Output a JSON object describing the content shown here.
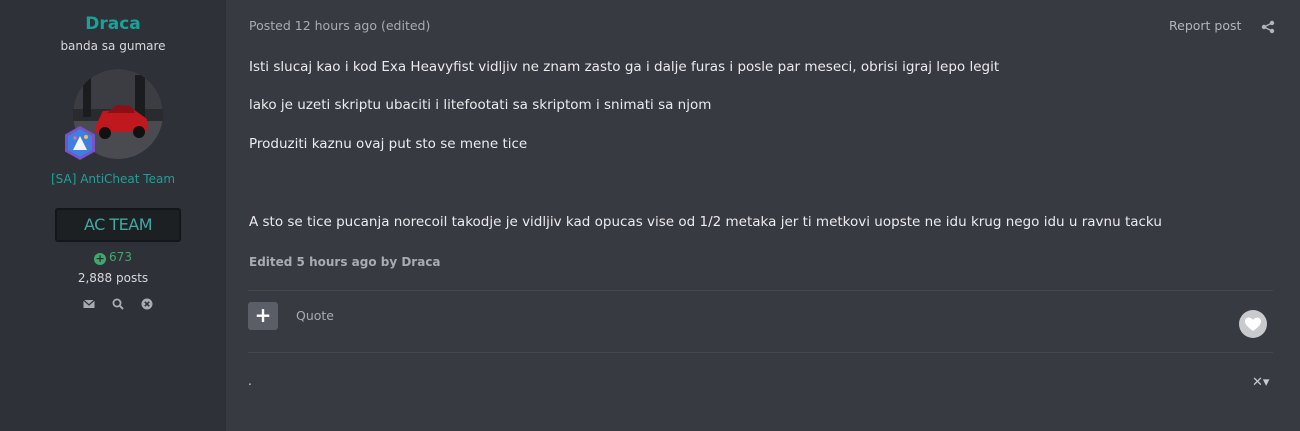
{
  "author": {
    "name": "Draca",
    "title": "banda sa gumare",
    "group": "[SA] AntiCheat Team",
    "group_badge": "AC TEAM",
    "reputation": "673",
    "posts": "2,888 posts",
    "icons": [
      "envelope-icon",
      "search-icon",
      "ignore-icon"
    ]
  },
  "post": {
    "posted": "Posted 12 hours ago (edited)",
    "report": "Report post",
    "paragraphs": [
      "Isti slucaj kao i kod Exa Heavyfist vidljiv ne znam zasto ga i dalje furas i posle par meseci, obrisi igraj lepo legit",
      "lako je uzeti skriptu ubaciti i litefootati sa skriptom i snimati sa njom",
      "Produziti kaznu ovaj put sto se mene tice",
      "A sto se tice pucanja norecoil takodje je vidljiv kad opucas vise od 1/2 metaka jer ti metkovi uopste ne idu krug nego idu u ravnu tacku"
    ],
    "edited": "Edited 5 hours ago by Draca",
    "quote": "Quote",
    "multiquote_symbol": "+",
    "reply_stub": ".",
    "close_menu": "✕▾"
  },
  "colors": {
    "background": "#383a42",
    "sidebar": "#2f3138",
    "accent": "#19a29a",
    "reputation": "#3fa86a"
  }
}
